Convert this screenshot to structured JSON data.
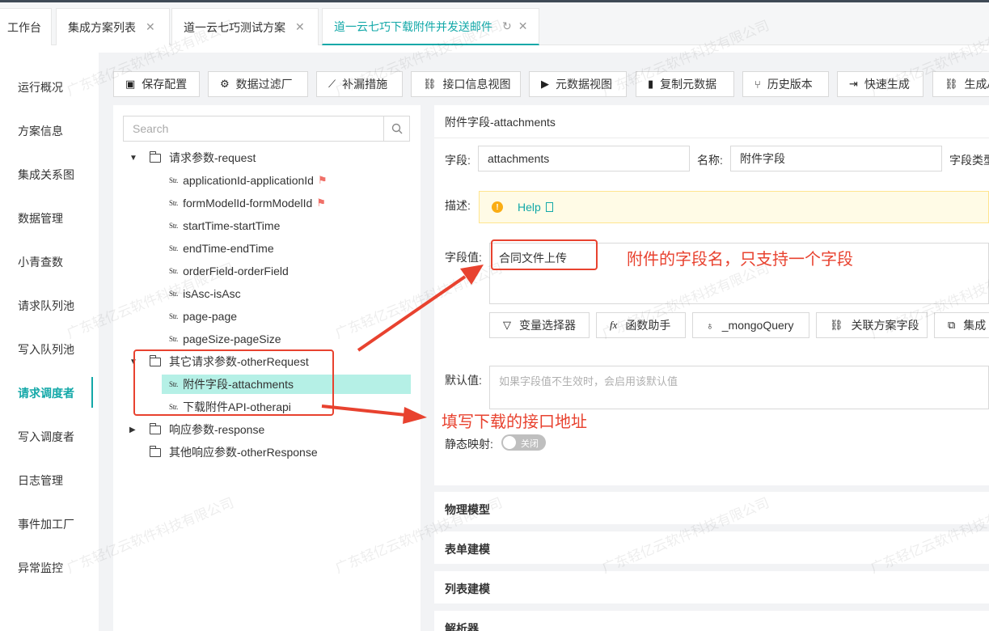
{
  "tabs": [
    {
      "label": "工作台",
      "closable": false
    },
    {
      "label": "集成方案列表",
      "closable": true
    },
    {
      "label": "道一云七巧测试方案",
      "closable": true
    },
    {
      "label": "道一云七巧下载附件并发送邮件",
      "closable": true,
      "active": true
    }
  ],
  "sidebar": {
    "items": [
      {
        "label": "运行概况"
      },
      {
        "label": "方案信息"
      },
      {
        "label": "集成关系图"
      },
      {
        "label": "数据管理"
      },
      {
        "label": "小青查数"
      },
      {
        "label": "请求队列池"
      },
      {
        "label": "写入队列池"
      },
      {
        "label": "请求调度者",
        "active": true
      },
      {
        "label": "写入调度者"
      },
      {
        "label": "日志管理"
      },
      {
        "label": "事件加工厂"
      },
      {
        "label": "异常监控"
      }
    ]
  },
  "toolbar": {
    "buttons": [
      {
        "label": "保存配置",
        "icon": "save-icon"
      },
      {
        "label": "数据过滤厂",
        "icon": "gear-icon"
      },
      {
        "label": "补漏措施",
        "icon": "chart-line-icon"
      },
      {
        "label": "接口信息视图",
        "icon": "link-icon"
      },
      {
        "label": "元数据视图",
        "icon": "terminal-icon"
      },
      {
        "label": "复制元数据",
        "icon": "copy-icon"
      },
      {
        "label": "历史版本",
        "icon": "branch-icon"
      },
      {
        "label": "快速生成",
        "icon": "export-icon"
      },
      {
        "label": "生成A",
        "icon": "link-icon"
      }
    ]
  },
  "tree": {
    "search_placeholder": "Search",
    "nodes": {
      "request": "请求参数-request",
      "applicationId": "applicationId-applicationId",
      "formModelId": "formModelId-formModelId",
      "startTime": "startTime-startTime",
      "endTime": "endTime-endTime",
      "orderField": "orderField-orderField",
      "isAsc": "isAsc-isAsc",
      "page": "page-page",
      "pageSize": "pageSize-pageSize",
      "otherRequest": "其它请求参数-otherRequest",
      "attachments": "附件字段-attachments",
      "otherapi": "下载附件API-otherapi",
      "response": "响应参数-response",
      "otherResponse": "其他响应参数-otherResponse"
    },
    "str_tag": "Str."
  },
  "detail": {
    "title": "附件字段-attachments",
    "field_label": "字段:",
    "field_value": "attachments",
    "name_label": "名称:",
    "name_value": "附件字段",
    "type_label": "字段类型",
    "desc_label": "描述:",
    "help_text": "Help",
    "value_label": "字段值:",
    "value_text": "合同文件上传",
    "helper_buttons": [
      {
        "label": "变量选择器",
        "icon": "filter-icon"
      },
      {
        "label": "函数助手",
        "icon": "fx-icon"
      },
      {
        "label": "_mongoQuery",
        "icon": "bulb-icon"
      },
      {
        "label": "关联方案字段",
        "icon": "link-icon"
      },
      {
        "label": "集成",
        "icon": "cluster-icon"
      }
    ],
    "default_label": "默认值:",
    "default_placeholder": "如果字段值不生效时，会启用该默认值",
    "static_label": "静态映射:",
    "static_switch": "关闭",
    "sections": [
      "物理模型",
      "表单建模",
      "列表建模",
      "解析器"
    ]
  },
  "annotations": {
    "field_note": "附件的字段名，只支持一个字段",
    "api_note": "填写下载的接口地址",
    "color": "#e8422f"
  },
  "watermark": "广东轻亿云软件科技有限公司",
  "colors": {
    "accent": "#13a8a8",
    "selected_row": "#b5f0e6"
  }
}
